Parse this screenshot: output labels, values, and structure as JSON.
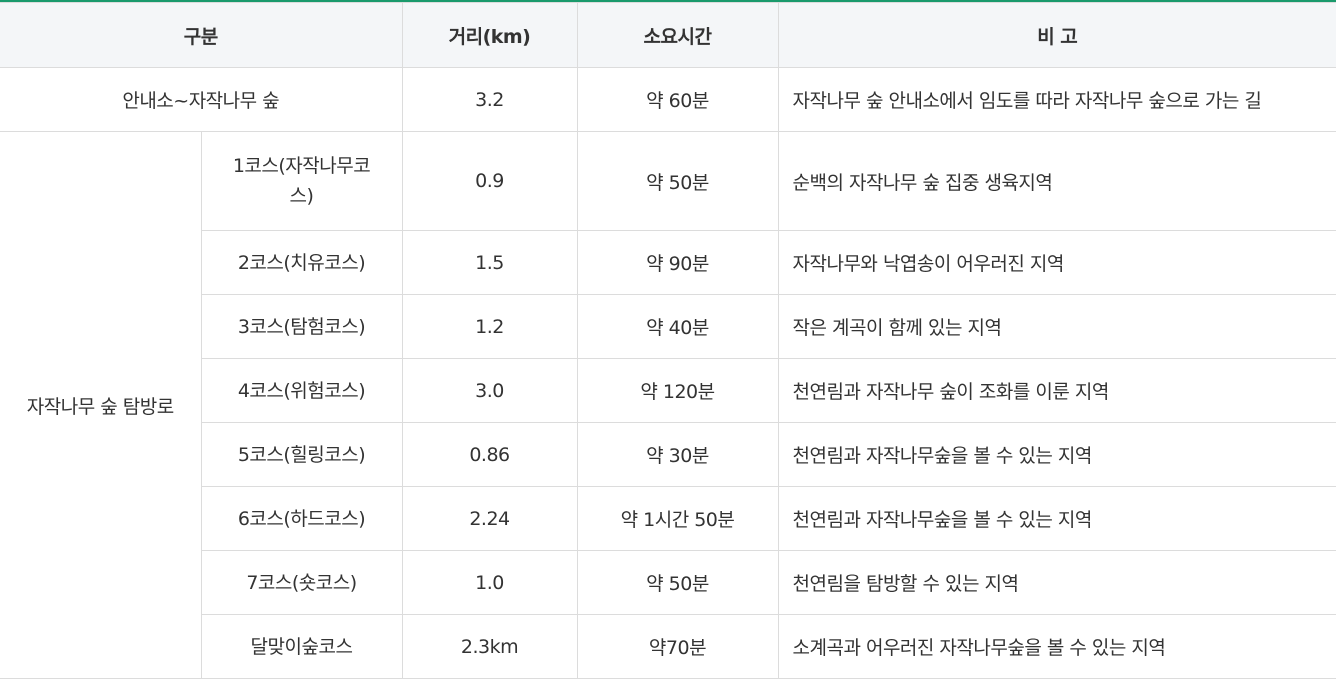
{
  "headers": {
    "division": "구분",
    "distance": "거리(km)",
    "duration": "소요시간",
    "note": "비 고"
  },
  "first_row": {
    "label": "안내소~자작나무 숲",
    "distance": "3.2",
    "duration": "약 60분",
    "note": "자작나무 숲 안내소에서 임도를 따라 자작나무 숲으로 가는 길"
  },
  "group_label": "자작나무 숲 탐방로",
  "courses": [
    {
      "name": "1코스(자작나무코스)",
      "distance": "0.9",
      "duration": "약 50분",
      "note": "순백의 자작나무 숲 집중 생육지역"
    },
    {
      "name": "2코스(치유코스)",
      "distance": "1.5",
      "duration": "약 90분",
      "note": "자작나무와 낙엽송이 어우러진 지역"
    },
    {
      "name": "3코스(탐험코스)",
      "distance": "1.2",
      "duration": "약 40분",
      "note": "작은 계곡이 함께 있는 지역"
    },
    {
      "name": "4코스(위험코스)",
      "distance": "3.0",
      "duration": "약 120분",
      "note": "천연림과 자작나무 숲이 조화를 이룬 지역"
    },
    {
      "name": "5코스(힐링코스)",
      "distance": "0.86",
      "duration": "약 30분",
      "note": "천연림과 자작나무숲을 볼 수 있는 지역"
    },
    {
      "name": "6코스(하드코스)",
      "distance": "2.24",
      "duration": "약 1시간 50분",
      "note": "천연림과 자작나무숲을 볼 수 있는 지역"
    },
    {
      "name": "7코스(숏코스)",
      "distance": "1.0",
      "duration": "약 50분",
      "note": "천연림을 탐방할 수 있는 지역"
    },
    {
      "name": "달맞이숲코스",
      "distance": "2.3km",
      "duration": "약70분",
      "note": "소계곡과 어우러진 자작나무숲을 볼 수 있는 지역"
    }
  ],
  "colors": {
    "accent_top_border": "#1a9a6c",
    "header_background": "#f4f6f8",
    "grid_line": "#dcdcdc",
    "text": "#333333"
  }
}
